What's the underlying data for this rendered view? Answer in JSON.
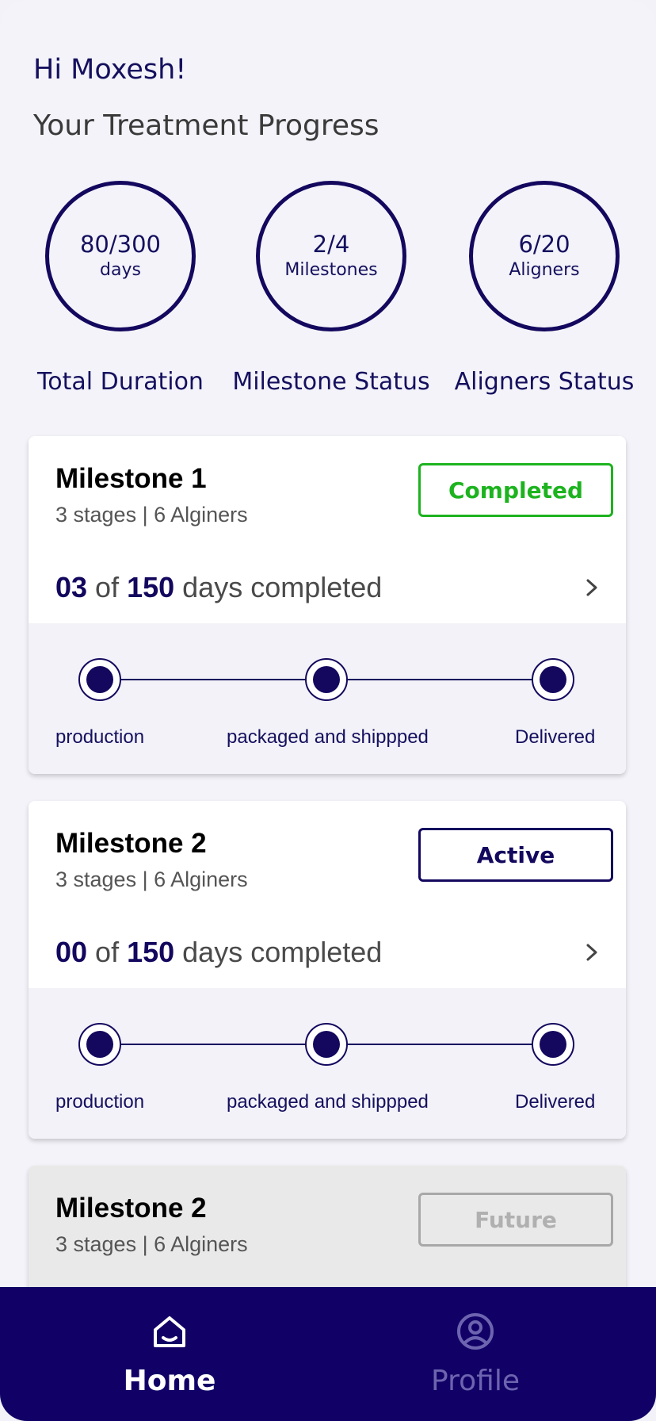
{
  "greeting": "Hi Moxesh!",
  "subtitle": "Your Treatment Progress",
  "stats": [
    {
      "value": "80/300",
      "unit": "days",
      "label": "Total Duration"
    },
    {
      "value": "2/4",
      "unit": "Milestones",
      "label": "Milestone Status"
    },
    {
      "value": "6/20",
      "unit": "Aligners",
      "label": "Aligners Status"
    }
  ],
  "milestones": [
    {
      "title": "Milestone 1",
      "subtitle": "3 stages | 6 Alginers",
      "status": "Completed",
      "days_done": "03",
      "of_text": "of",
      "days_total": "150",
      "days_suffix": "days completed",
      "stages": [
        "production",
        "packaged and shippped",
        "Delivered"
      ]
    },
    {
      "title": "Milestone 2",
      "subtitle": "3 stages | 6 Alginers",
      "status": "Active",
      "days_done": "00",
      "of_text": "of",
      "days_total": "150",
      "days_suffix": "days completed",
      "stages": [
        "production",
        "packaged and shippped",
        "Delivered"
      ]
    },
    {
      "title": "Milestone 2",
      "subtitle": "3 stages | 6 Alginers",
      "status": "Future"
    }
  ],
  "nav": {
    "home_label": "Home",
    "profile_label": "Profile",
    "home_icon": "home-icon",
    "profile_icon": "user-circle-icon"
  },
  "colors": {
    "primary": "#110066",
    "completed": "#1db31f",
    "future": "#a8a8a8",
    "background": "#f3f3f9"
  }
}
